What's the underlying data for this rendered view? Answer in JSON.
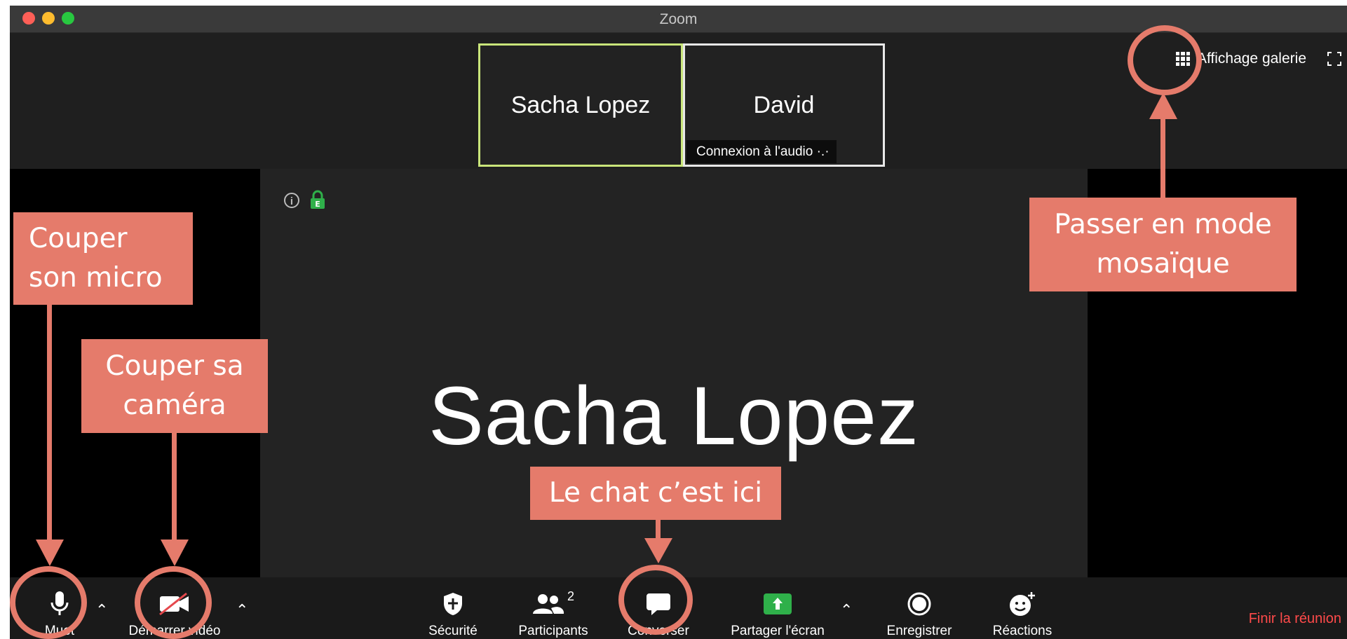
{
  "window": {
    "title": "Zoom"
  },
  "thumbnails": [
    {
      "name": "Sacha Lopez"
    },
    {
      "name": "David",
      "status": "Connexion à l'audio ·.·"
    }
  ],
  "gallery_view": {
    "label": "Affichage galerie"
  },
  "active_speaker": {
    "name": "Sacha Lopez"
  },
  "toolbar": {
    "mute": "Muet",
    "video": "Démarrer vidéo",
    "security": "Sécurité",
    "participants": "Participants",
    "participants_count": "2",
    "chat": "Converser",
    "share": "Partager l'écran",
    "record": "Enregistrer",
    "reactions": "Réactions",
    "end": "Finir la réunion"
  },
  "annotations": {
    "mic": [
      "Couper",
      "son micro"
    ],
    "camera": [
      "Couper sa",
      "caméra"
    ],
    "chat": "Le chat c’est ici",
    "gallery": [
      "Passer en mode",
      "mosaïque"
    ]
  },
  "colors": {
    "annotation": "#e57b6b",
    "active_border": "#c9e57a",
    "end_meeting": "#ff4a4a",
    "share_green": "#2fb04a"
  }
}
